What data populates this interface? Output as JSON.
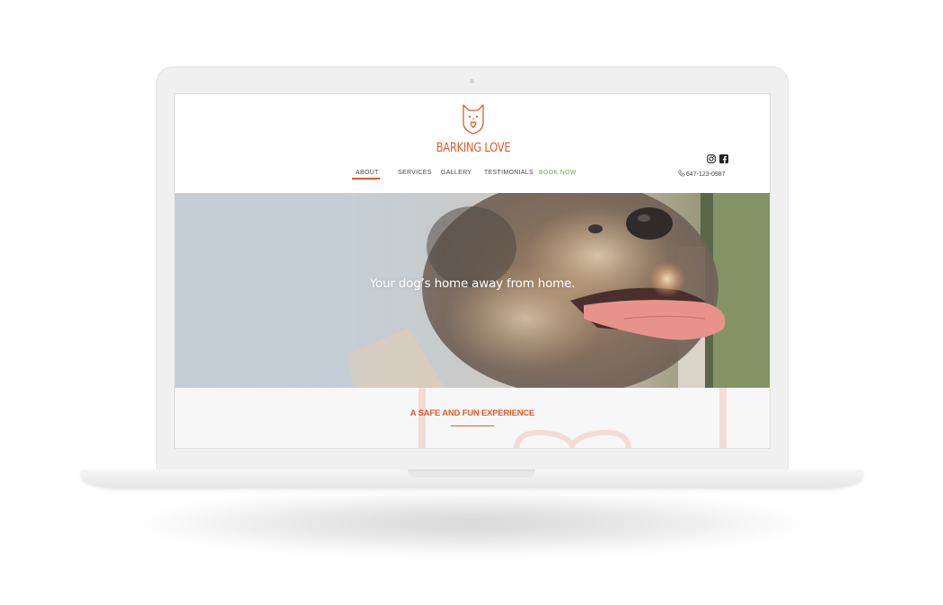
{
  "brand": {
    "name": "BARKING LOVE",
    "logo_icon": "dog-heart-icon",
    "accent_color": "#e05a2b"
  },
  "nav": {
    "items": [
      {
        "label": "ABOUT",
        "active": true
      },
      {
        "label": "SERVICES",
        "active": false
      },
      {
        "label": "GALLERY",
        "active": false
      },
      {
        "label": "TESTIMONIALS",
        "active": false
      },
      {
        "label": "BOOK NOW",
        "active": false,
        "color": "#6aa84f"
      }
    ]
  },
  "contact": {
    "phone": "647-123-0987",
    "phone_icon": "phone-icon"
  },
  "social": {
    "icons": [
      "instagram-icon",
      "facebook-icon"
    ]
  },
  "hero": {
    "tagline": "Your dog’s home away from home."
  },
  "section": {
    "title": "A SAFE AND FUN EXPERIENCE"
  }
}
